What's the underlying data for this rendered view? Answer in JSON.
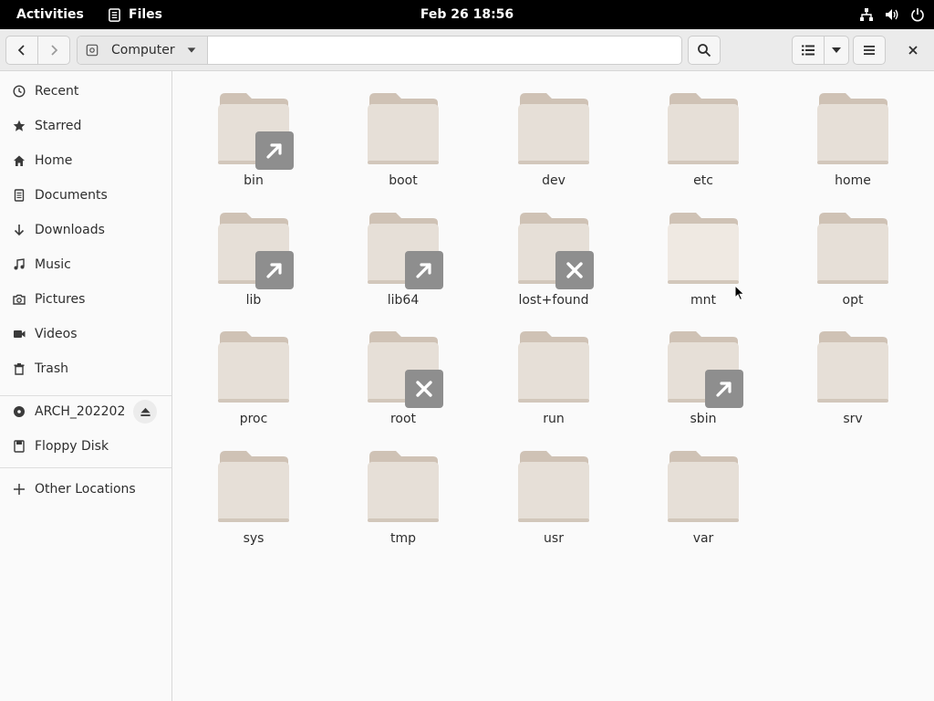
{
  "topbar": {
    "activities": "Activities",
    "app_name": "Files",
    "datetime": "Feb 26  18:56",
    "status_icons": [
      "network-icon",
      "volume-icon",
      "power-icon"
    ]
  },
  "headerbar": {
    "location": "Computer",
    "buttons": [
      "back",
      "forward",
      "location-dropdown",
      "search",
      "view-list",
      "view-options",
      "main-menu",
      "close"
    ]
  },
  "sidebar": {
    "items": [
      {
        "label": "Recent",
        "icon": "clock-icon"
      },
      {
        "label": "Starred",
        "icon": "star-icon"
      },
      {
        "label": "Home",
        "icon": "home-icon"
      },
      {
        "label": "Documents",
        "icon": "document-icon"
      },
      {
        "label": "Downloads",
        "icon": "download-icon"
      },
      {
        "label": "Music",
        "icon": "music-icon"
      },
      {
        "label": "Pictures",
        "icon": "camera-icon"
      },
      {
        "label": "Videos",
        "icon": "video-icon"
      },
      {
        "label": "Trash",
        "icon": "trash-icon"
      }
    ],
    "devices": [
      {
        "label": "ARCH_202202",
        "icon": "disc-icon",
        "eject": true
      },
      {
        "label": "Floppy Disk",
        "icon": "floppy-icon"
      }
    ],
    "other": {
      "label": "Other Locations",
      "icon": "plus-icon"
    }
  },
  "files": [
    {
      "name": "bin",
      "badge": "link"
    },
    {
      "name": "boot",
      "badge": ""
    },
    {
      "name": "dev",
      "badge": ""
    },
    {
      "name": "etc",
      "badge": ""
    },
    {
      "name": "home",
      "badge": ""
    },
    {
      "name": "lib",
      "badge": "link"
    },
    {
      "name": "lib64",
      "badge": "link"
    },
    {
      "name": "lost+found",
      "badge": "noaccess"
    },
    {
      "name": "mnt",
      "badge": "",
      "hover": true
    },
    {
      "name": "opt",
      "badge": ""
    },
    {
      "name": "proc",
      "badge": ""
    },
    {
      "name": "root",
      "badge": "noaccess"
    },
    {
      "name": "run",
      "badge": ""
    },
    {
      "name": "sbin",
      "badge": "link"
    },
    {
      "name": "srv",
      "badge": ""
    },
    {
      "name": "sys",
      "badge": ""
    },
    {
      "name": "tmp",
      "badge": ""
    },
    {
      "name": "usr",
      "badge": ""
    },
    {
      "name": "var",
      "badge": ""
    }
  ],
  "colors": {
    "folder_back": "#cfc2b5",
    "folder_front": "#e6dfd7",
    "folder_front_hover": "#efe9e2",
    "badge": "#8e8e8e",
    "topbar": "#000000"
  }
}
